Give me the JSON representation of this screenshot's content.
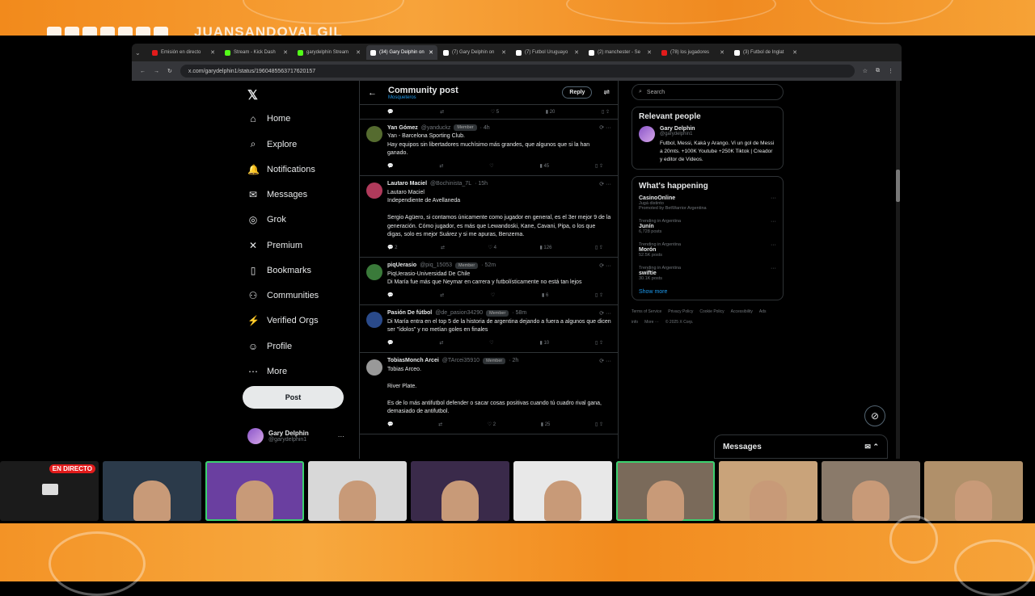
{
  "stream": {
    "handle": "JUANSANDOVALGIL",
    "live_badge": "EN DIRECTO"
  },
  "browser": {
    "tabs": [
      {
        "label": "Emisión en directo",
        "color": "#e21b1b"
      },
      {
        "label": "Stream - Kick Dash",
        "color": "#53fc18"
      },
      {
        "label": "garydelphin Stream",
        "color": "#53fc18"
      },
      {
        "label": "(34) Gary Delphin on",
        "color": "#ffffff"
      },
      {
        "label": "(7) Gary Delphin on",
        "color": "#ffffff"
      },
      {
        "label": "(7) Futbol Uruguayo",
        "color": "#ffffff"
      },
      {
        "label": "(2) manchester - Se",
        "color": "#ffffff"
      },
      {
        "label": "(78) los jugadores",
        "color": "#e21b1b"
      },
      {
        "label": "(3) Futbol de Inglat",
        "color": "#ffffff"
      }
    ],
    "url": "x.com/garydelphin1/status/1960485563717620157"
  },
  "nav": {
    "items": [
      {
        "label": "Home",
        "icon": "⌂"
      },
      {
        "label": "Explore",
        "icon": "⌕"
      },
      {
        "label": "Notifications",
        "icon": "🔔"
      },
      {
        "label": "Messages",
        "icon": "✉"
      },
      {
        "label": "Grok",
        "icon": "◎"
      },
      {
        "label": "Premium",
        "icon": "✕"
      },
      {
        "label": "Bookmarks",
        "icon": "▯"
      },
      {
        "label": "Communities",
        "icon": "⚇"
      },
      {
        "label": "Verified Orgs",
        "icon": "⚡"
      },
      {
        "label": "Profile",
        "icon": "☺"
      },
      {
        "label": "More",
        "icon": "⋯"
      }
    ],
    "post_label": "Post",
    "profile_name": "Gary Delphin",
    "profile_handle": "@garydelphin1"
  },
  "main": {
    "title": "Community post",
    "subtitle": "Mosqueteros",
    "reply_label": "Reply",
    "top_actions": {
      "likes": "5",
      "views": "20"
    },
    "tweets": [
      {
        "name": "Yan Gómez",
        "handle": "@yanduckz",
        "badge": "Member",
        "time": "4h",
        "text": "Yan - Barcelona Sporting Club.\nHay equipos sin libertadores muchísimo más grandes, que algunos que si la han ganado.",
        "replies": "",
        "likes": "",
        "views": "45",
        "avatar": "#556b2f"
      },
      {
        "name": "Lautaro Maciel",
        "handle": "@Bochinista_7L",
        "badge": "",
        "time": "15h",
        "text": "Lautaro Maciel\nIndependiente de Avellaneda\n\nSergio Agüero, si contamos únicamente como jugador en general, es el 3er mejor 9 de la generación. Cómo jugador, es más que Lewandoski, Kane, Cavani, Pipa, o los que digas, solo es mejor Suárez y si me apuras, Benzema.",
        "replies": "2",
        "likes": "4",
        "views": "126",
        "avatar": "#b03a5b"
      },
      {
        "name": "piqUerasio",
        "handle": "@piq_15053",
        "badge": "Member",
        "time": "52m",
        "text": "PiqUerasio-Universidad De Chile\nDi María fue más que Neymar en carrera y futbolísticamente no está tan lejos",
        "replies": "",
        "likes": "",
        "views": "6",
        "avatar": "#3a7a3a"
      },
      {
        "name": "Pasión De fútbol",
        "handle": "@de_pasion34290",
        "badge": "Member",
        "time": "58m",
        "text": "Di María entra en el top 5 de la historia de argentina dejando a fuera a algunos que dicen ser \"ídolos\" y no metían goles en finales",
        "replies": "",
        "likes": "",
        "views": "10",
        "avatar": "#2a4a8a"
      },
      {
        "name": "TobiasMonch Arcei",
        "handle": "@TArcei35910",
        "badge": "Member",
        "time": "2h",
        "text": "Tobias Arceo.\n\nRiver Plate.\n\nEs de lo más antifutbol defender o sacar cosas positivas cuando tú cuadro rival gana, demasiado de antifutbol.",
        "replies": "",
        "likes": "2",
        "views": "25",
        "avatar": "#999999"
      }
    ]
  },
  "right": {
    "search_placeholder": "Search",
    "relevant_title": "Relevant people",
    "person_name": "Gary Delphin",
    "person_handle": "@garydelphin1",
    "person_bio": "Futbol, Messi, Kaká y Arango. Vi un gol de Messi a 20mts. +100K Youtube +250K Tiktok | Creador y editor de Videos.",
    "happening_title": "What's happening",
    "trends": [
      {
        "cat": "",
        "name": "CasinoOnline",
        "sub": "Jugá distinto",
        "extra": "Promoted by BetWarrior Argentina"
      },
      {
        "cat": "Trending in Argentina",
        "name": "Junín",
        "sub": "6,728 posts",
        "extra": ""
      },
      {
        "cat": "Trending in Argentina",
        "name": "Morón",
        "sub": "52.5K posts",
        "extra": ""
      },
      {
        "cat": "Trending in Argentina",
        "name": "swiftie",
        "sub": "30.1K posts",
        "extra": ""
      }
    ],
    "show_more": "Show more",
    "footer": [
      "Terms of Service",
      "Privacy Policy",
      "Cookie Policy",
      "Accessibility",
      "Ads info",
      "More ···",
      "© 2025 X Corp."
    ]
  },
  "messages_label": "Messages",
  "cams": [
    "#1b1b1b",
    "#2b3a4a",
    "#6a3fa0",
    "#d8d8d8",
    "#3a2a4a",
    "#e8e8e8",
    "#7a6a5a",
    "#c9a37a",
    "#8a7a6a",
    "#b0906a"
  ]
}
